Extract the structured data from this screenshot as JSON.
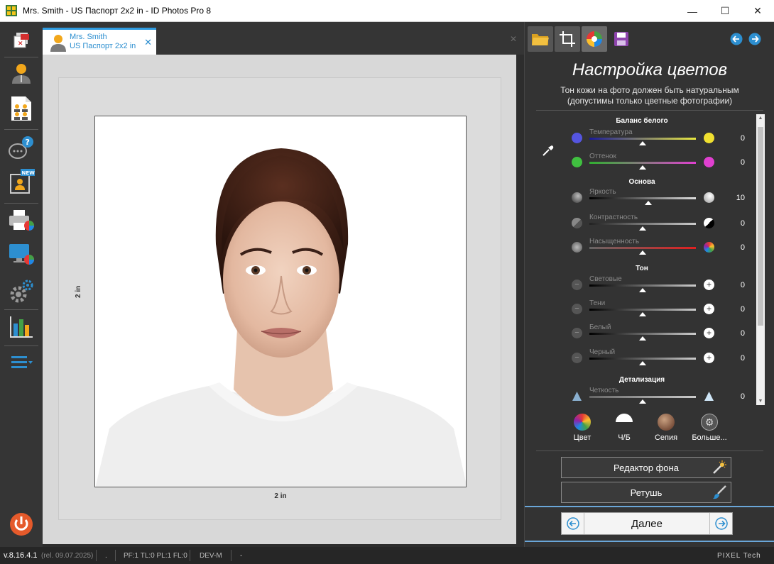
{
  "window": {
    "title": "Mrs. Smith - US Паспорт 2x2 in - ID Photos Pro 8",
    "minimize_glyph": "—",
    "maximize_glyph": "☐",
    "close_glyph": "✕"
  },
  "left_toolbar": {
    "items": [
      "close-project-icon",
      "person-icon",
      "photo-sheet-icon",
      "help-chat-icon",
      "new-id-template-icon",
      "print-icon",
      "display-color-icon",
      "settings-icon",
      "stats-chart-icon",
      "menu-icon"
    ],
    "new_badge": "NEW",
    "power_icon": "power-icon"
  },
  "tab": {
    "line1": "Mrs. Smith",
    "line2": "US Паспорт 2x2 in",
    "close_glyph": "✕",
    "strip_close_glyph": "✕"
  },
  "photo": {
    "width_label": "2 in",
    "height_label": "2 in"
  },
  "panel": {
    "title": "Настройка цветов",
    "subtitle_line1": "Тон кожи на фото должен быть натуральным",
    "subtitle_line2": "(допустимы только цветные фотографии)",
    "sections": {
      "white_balance": "Баланс белого",
      "basic": "Основа",
      "tone": "Тон",
      "detail": "Детализация"
    },
    "sliders": {
      "temperature": {
        "label": "Температура",
        "value": "0",
        "position": 0.5
      },
      "tint": {
        "label": "Оттенок",
        "value": "0",
        "position": 0.5
      },
      "brightness": {
        "label": "Яркость",
        "value": "10",
        "position": 0.55
      },
      "contrast": {
        "label": "Контрастность",
        "value": "0",
        "position": 0.5
      },
      "saturation": {
        "label": "Насыщенность",
        "value": "0",
        "position": 0.5
      },
      "highlights": {
        "label": "Световые",
        "value": "0",
        "position": 0.5
      },
      "shadows": {
        "label": "Тени",
        "value": "0",
        "position": 0.5
      },
      "whites": {
        "label": "Белый",
        "value": "0",
        "position": 0.5
      },
      "blacks": {
        "label": "Черный",
        "value": "0",
        "position": 0.5
      },
      "sharpness": {
        "label": "Четкость",
        "value": "0",
        "position": 0.5
      }
    },
    "modes": {
      "color": "Цвет",
      "bw": "Ч/Б",
      "sepia": "Сепия",
      "more": "Больше..."
    },
    "background_editor": "Редактор фона",
    "retouch": "Ретушь",
    "next": "Далее"
  },
  "status": {
    "version": "v.8.16.4.1",
    "release": "(rel. 09.07.2025)",
    "dot": ".",
    "flags": "PF:1 TL:0 PL:1 FL:0",
    "dev": "DEV-M",
    "dash": "-",
    "brand": "PIXEL Tech"
  }
}
